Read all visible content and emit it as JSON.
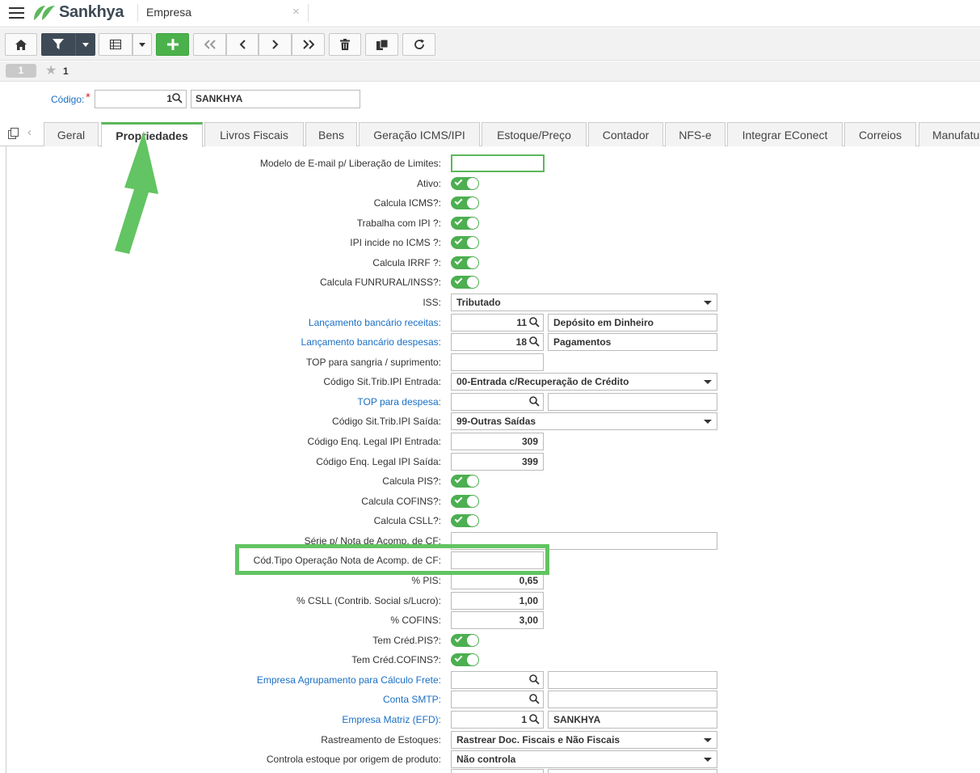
{
  "app": {
    "logo": "Sankhya",
    "tab_title": "Empresa",
    "tab_close": "×"
  },
  "record": {
    "badge": "1",
    "number": "1"
  },
  "header": {
    "code_label": "Código:",
    "required_mark": "*",
    "code_value": "1",
    "code_desc": "SANKHYA"
  },
  "tabs": [
    {
      "label": "Geral"
    },
    {
      "label": "Propriedades",
      "active": true
    },
    {
      "label": "Livros Fiscais"
    },
    {
      "label": "Bens"
    },
    {
      "label": "Geração ICMS/IPI"
    },
    {
      "label": "Estoque/Preço"
    },
    {
      "label": "Contador"
    },
    {
      "label": "NFS-e"
    },
    {
      "label": "Integrar EConect"
    },
    {
      "label": "Correios"
    },
    {
      "label": "Manufatura"
    }
  ],
  "fields": [
    {
      "label": "Modelo de E-mail p/ Liberação de Limites:",
      "type": "input-focus",
      "value": ""
    },
    {
      "label": "Ativo:",
      "type": "toggle",
      "on": true
    },
    {
      "label": "Calcula ICMS?:",
      "type": "toggle",
      "on": true
    },
    {
      "label": "Trabalha com IPI ?:",
      "type": "toggle",
      "on": true
    },
    {
      "label": "IPI incide no ICMS ?:",
      "type": "toggle",
      "on": true
    },
    {
      "label": "Calcula IRRF ?:",
      "type": "toggle",
      "on": true
    },
    {
      "label": "Calcula FUNRURAL/INSS?:",
      "type": "toggle",
      "on": true
    },
    {
      "label": "ISS:",
      "type": "select",
      "value": "Tributado"
    },
    {
      "label": "Lançamento bancário receitas:",
      "type": "lookup",
      "link": true,
      "value": "11",
      "desc": "Depósito em Dinheiro"
    },
    {
      "label": "Lançamento bancário despesas:",
      "type": "lookup",
      "link": true,
      "value": "18",
      "desc": "Pagamentos"
    },
    {
      "label": "TOP para sangria / suprimento:",
      "type": "input-short",
      "value": ""
    },
    {
      "label": "Código Sit.Trib.IPI Entrada:",
      "type": "select",
      "value": "00-Entrada c/Recuperação de Crédito"
    },
    {
      "label": "TOP para despesa:",
      "type": "lookup",
      "link": true,
      "value": "",
      "desc": ""
    },
    {
      "label": "Código Sit.Trib.IPI Saída:",
      "type": "select",
      "value": "99-Outras Saídas"
    },
    {
      "label": "Código Enq. Legal IPI Entrada:",
      "type": "number",
      "value": "309"
    },
    {
      "label": "Código Enq. Legal IPI Saída:",
      "type": "number",
      "value": "399"
    },
    {
      "label": "Calcula PIS?:",
      "type": "toggle",
      "on": true
    },
    {
      "label": "Calcula COFINS?:",
      "type": "toggle",
      "on": true
    },
    {
      "label": "Calcula CSLL?:",
      "type": "toggle",
      "on": true
    },
    {
      "label": "Série p/ Nota de Acomp. de CF:",
      "type": "input-long",
      "value": ""
    },
    {
      "label": "Cód.Tipo Operação Nota de Acomp. de CF:",
      "type": "input-short",
      "value": ""
    },
    {
      "label": "% PIS:",
      "type": "number",
      "value": "0,65"
    },
    {
      "label": "% CSLL (Contrib. Social s/Lucro):",
      "type": "number",
      "value": "1,00"
    },
    {
      "label": "% COFINS:",
      "type": "number",
      "value": "3,00"
    },
    {
      "label": "Tem Créd.PIS?:",
      "type": "toggle",
      "on": true
    },
    {
      "label": "Tem Créd.COFINS?:",
      "type": "toggle",
      "on": true
    },
    {
      "label": "Empresa Agrupamento para Cálculo Frete:",
      "type": "lookup",
      "link": true,
      "value": "",
      "desc": ""
    },
    {
      "label": "Conta SMTP:",
      "type": "lookup",
      "link": true,
      "value": "",
      "desc": ""
    },
    {
      "label": "Empresa Matriz (EFD):",
      "type": "lookup",
      "link": true,
      "value": "1",
      "desc": "SANKHYA"
    },
    {
      "label": "Rastreamento de Estoques:",
      "type": "select",
      "value": "Rastrear Doc. Fiscais e Não Fiscais"
    },
    {
      "label": "Controla estoque por origem de produto:",
      "type": "select",
      "value": "Não controla"
    }
  ],
  "colors": {
    "accent": "#5cb85c",
    "link": "#1a6fc4",
    "toggle": "#4caf50",
    "annotation": "#62c462"
  }
}
